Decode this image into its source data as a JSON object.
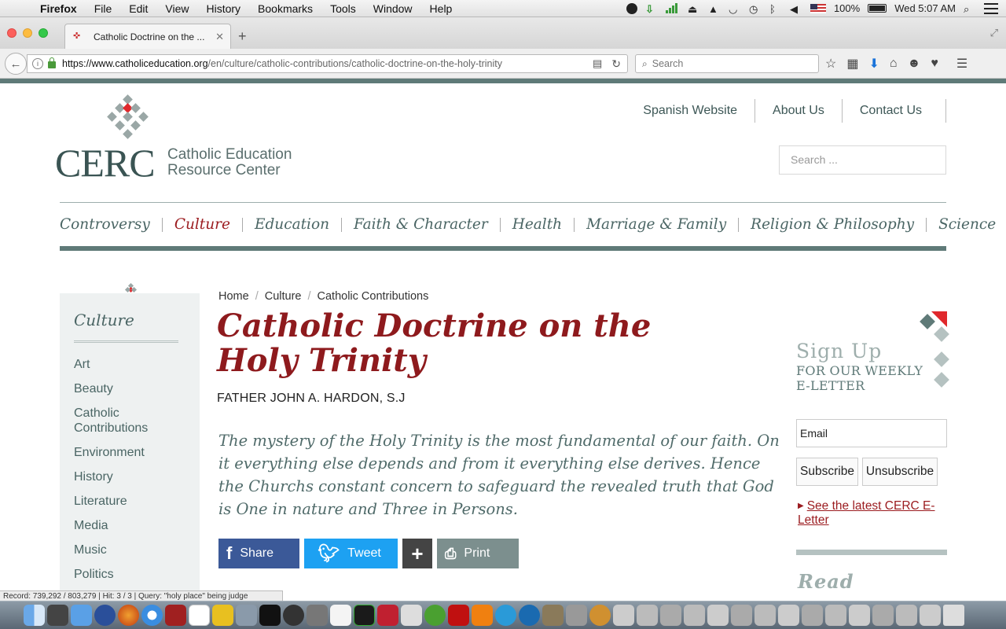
{
  "menubar": {
    "app": "Firefox",
    "items": [
      "File",
      "Edit",
      "View",
      "History",
      "Bookmarks",
      "Tools",
      "Window",
      "Help"
    ],
    "battery": "100%",
    "clock": "Wed 5:07 AM"
  },
  "browser": {
    "tab_title": "Catholic Doctrine on the ...",
    "url_host": "https://www.catholiceducation.org",
    "url_path": "/en/culture/catholic-contributions/catholic-doctrine-on-the-holy-trinity",
    "search_placeholder": "Search"
  },
  "site": {
    "logo_text": "CERC",
    "logo_line1": "Catholic Education",
    "logo_line2": "Resource Center",
    "top_links": [
      "Spanish Website",
      "About Us",
      "Contact Us"
    ],
    "search_placeholder": "Search ...",
    "nav": [
      "Controversy",
      "Culture",
      "Education",
      "Faith & Character",
      "Health",
      "Marriage & Family",
      "Religion & Philosophy",
      "Science"
    ],
    "nav_active": "Culture"
  },
  "sidebar": {
    "title": "Culture",
    "items": [
      "Art",
      "Beauty",
      "Catholic Contributions",
      "Environment",
      "History",
      "Literature",
      "Media",
      "Music",
      "Politics"
    ]
  },
  "article": {
    "breadcrumb": [
      "Home",
      "Culture",
      "Catholic Contributions"
    ],
    "title": "Catholic Doctrine on the Holy Trinity",
    "author": "FATHER JOHN A. HARDON, S.J",
    "intro": "The mystery of the Holy Trinity is the most fundamental of our faith. On it everything else depends and from it everything else derives. Hence the Churchs constant concern to safeguard the revealed truth that God is One in nature and Three in Persons.",
    "share_label": "Share",
    "tweet_label": "Tweet",
    "print_label": "Print"
  },
  "signup": {
    "title": "Sign Up",
    "sub1": "FOR OUR WEEKLY",
    "sub2": "E-LETTER",
    "email_placeholder": "Email",
    "subscribe": "Subscribe",
    "unsubscribe": "Unsubscribe",
    "latest_link": "See the latest CERC E-Letter",
    "read_title": "Read"
  },
  "statusbar": {
    "text": "Record: 739,292 / 803,279 | Hit: 3 / 3 | Query: \"holy place\" being judge"
  },
  "colors": {
    "brand_teal": "#5f7a78",
    "brand_red": "#8e1a1d",
    "facebook": "#3b5998",
    "twitter": "#1da1f2"
  }
}
